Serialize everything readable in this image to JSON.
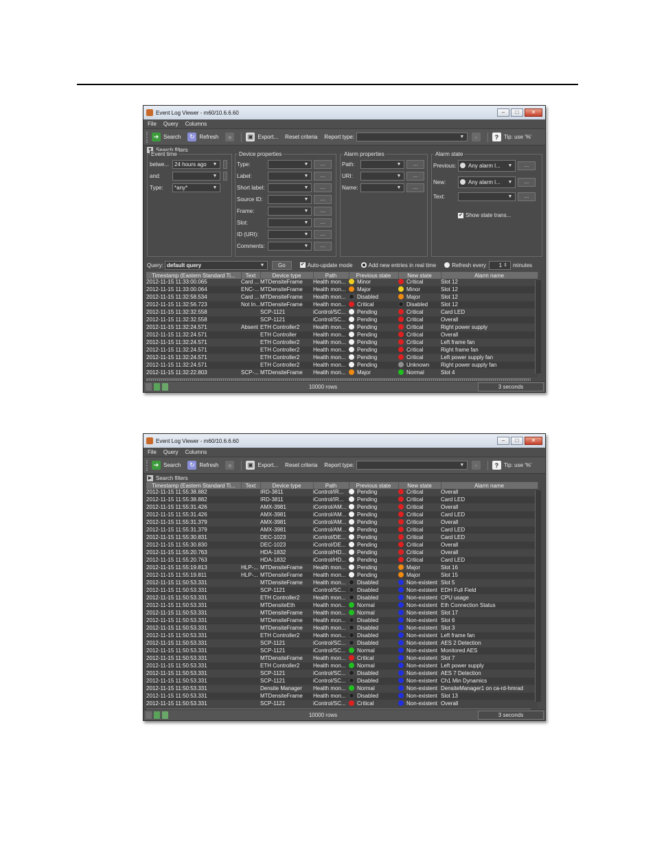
{
  "colors": {
    "critical": "#e02020",
    "major": "#f08a10",
    "minor": "#f0d020",
    "pending": "#f4f4f4",
    "disabled": "#202020",
    "normal": "#20c020",
    "nonexistent": "#2030e0",
    "unknown": "#909090"
  },
  "win1": {
    "title": "Event Log Viewer - m60/10.6.6.60",
    "menu": [
      "File",
      "Query",
      "Columns"
    ],
    "toolbar": {
      "search": "Search",
      "refresh": "Refresh",
      "export": "Export...",
      "reset": "Reset criteria",
      "report_type": "Report type:",
      "tip": "Tip: use '%'"
    },
    "filters_label": "Search filters",
    "event_time": {
      "legend": "Event time",
      "between_label": "betwe...",
      "between_value": "24 hours ago",
      "and_label": "and:",
      "and_value": "",
      "type_label": "Type:",
      "type_value": "*any*"
    },
    "device": {
      "legend": "Device properties",
      "labels": [
        "Type:",
        "Label:",
        "Short label:",
        "Source ID:",
        "Frame:",
        "Slot:",
        "ID (URI):",
        "Comments:"
      ]
    },
    "alarm": {
      "legend": "Alarm properties",
      "labels": [
        "Path:",
        "URI:",
        "Name:"
      ]
    },
    "alarm_state": {
      "legend": "Alarm state",
      "previous_label": "Previous:",
      "previous_value": "Any alarm l...",
      "new_label": "New:",
      "new_value": "Any alarm l...",
      "text_label": "Text:",
      "show_trans": "Show state trans..."
    },
    "query": {
      "label": "Query:",
      "value": "default query",
      "go": "Go",
      "auto_update": "Auto-update mode",
      "add_new": "Add new entries in real time",
      "refresh_every": "Refresh every",
      "refresh_value": "1",
      "minutes": "minutes"
    },
    "columns": [
      "Timestamp (Eastern Standard Ti...",
      "Text",
      "Device type",
      "Path",
      "Previous state",
      "New state",
      "Alarm name"
    ],
    "rows": [
      {
        "ts": "2012-11-15 11:33:00.065",
        "text": "Card ...",
        "dev": "MTDensiteFrame",
        "path": "Health mon...",
        "prev": "Minor",
        "pc": "minor",
        "new": "Critical",
        "nc": "critical",
        "alarm": "Slot 12"
      },
      {
        "ts": "2012-11-15 11:33:00.064",
        "text": "ENC-...",
        "dev": "MTDensiteFrame",
        "path": "Health mon...",
        "prev": "Major",
        "pc": "major",
        "new": "Minor",
        "nc": "minor",
        "alarm": "Slot 12"
      },
      {
        "ts": "2012-11-15 11:32:58.534",
        "text": "Card ...",
        "dev": "MTDensiteFrame",
        "path": "Health mon...",
        "prev": "Disabled",
        "pc": "disabled",
        "new": "Major",
        "nc": "major",
        "alarm": "Slot 12"
      },
      {
        "ts": "2012-11-15 11:32:56.723",
        "text": "Not In...",
        "dev": "MTDensiteFrame",
        "path": "Health mon...",
        "prev": "Critical",
        "pc": "critical",
        "new": "Disabled",
        "nc": "disabled",
        "alarm": "Slot 12"
      },
      {
        "ts": "2012-11-15 11:32:32.558",
        "text": "",
        "dev": "SCP-1121",
        "path": "iControl/SC...",
        "prev": "Pending",
        "pc": "pending",
        "new": "Critical",
        "nc": "critical",
        "alarm": "Card LED"
      },
      {
        "ts": "2012-11-15 11:32:32.558",
        "text": "",
        "dev": "SCP-1121",
        "path": "iControl/SC...",
        "prev": "Pending",
        "pc": "pending",
        "new": "Critical",
        "nc": "critical",
        "alarm": "Overall"
      },
      {
        "ts": "2012-11-15 11:32:24.571",
        "text": "Absent",
        "dev": "ETH Controller2",
        "path": "Health mon...",
        "prev": "Pending",
        "pc": "pending",
        "new": "Critical",
        "nc": "critical",
        "alarm": "Right power supply"
      },
      {
        "ts": "2012-11-15 11:32:24.571",
        "text": "",
        "dev": "ETH Controller",
        "path": "Health mon...",
        "prev": "Pending",
        "pc": "pending",
        "new": "Critical",
        "nc": "critical",
        "alarm": "Overall"
      },
      {
        "ts": "2012-11-15 11:32:24.571",
        "text": "",
        "dev": "ETH Controller2",
        "path": "Health mon...",
        "prev": "Pending",
        "pc": "pending",
        "new": "Critical",
        "nc": "critical",
        "alarm": "Left frame fan"
      },
      {
        "ts": "2012-11-15 11:32:24.571",
        "text": "",
        "dev": "ETH Controller2",
        "path": "Health mon...",
        "prev": "Pending",
        "pc": "pending",
        "new": "Critical",
        "nc": "critical",
        "alarm": "Right frame fan"
      },
      {
        "ts": "2012-11-15 11:32:24.571",
        "text": "",
        "dev": "ETH Controller2",
        "path": "Health mon...",
        "prev": "Pending",
        "pc": "pending",
        "new": "Critical",
        "nc": "critical",
        "alarm": "Left power supply fan"
      },
      {
        "ts": "2012-11-15 11:32:24.571",
        "text": "",
        "dev": "ETH Controller2",
        "path": "Health mon...",
        "prev": "Pending",
        "pc": "pending",
        "new": "Unknown",
        "nc": "unknown",
        "alarm": "Right power supply fan"
      },
      {
        "ts": "2012-11-15 11:32:22.803",
        "text": "SCP-...",
        "dev": "MTDensiteFrame",
        "path": "Health mon...",
        "prev": "Major",
        "pc": "major",
        "new": "Normal",
        "nc": "normal",
        "alarm": "Slot 4"
      }
    ],
    "status": {
      "rows": "10000 rows",
      "refresh": "3 seconds"
    }
  },
  "win2": {
    "title": "Event Log Viewer - m60/10.6.6.60",
    "menu": [
      "File",
      "Query",
      "Columns"
    ],
    "toolbar": {
      "search": "Search",
      "refresh": "Refresh",
      "export": "Export...",
      "reset": "Reset criteria",
      "report_type": "Report type:",
      "tip": "Tip: use '%'"
    },
    "filters_label": "Search filters",
    "columns": [
      "Timestamp (Eastern Standard Ti...",
      "Text",
      "Device type",
      "Path",
      "Previous state",
      "New state",
      "Alarm name"
    ],
    "rows": [
      {
        "ts": "2012-11-15 11:55:38.882",
        "text": "",
        "dev": "IRD-3811",
        "path": "iControl/IR...",
        "prev": "Pending",
        "pc": "pending",
        "new": "Critical",
        "nc": "critical",
        "alarm": "Overall"
      },
      {
        "ts": "2012-11-15 11:55:38.882",
        "text": "",
        "dev": "IRD-3811",
        "path": "iControl/IR...",
        "prev": "Pending",
        "pc": "pending",
        "new": "Critical",
        "nc": "critical",
        "alarm": "Card LED"
      },
      {
        "ts": "2012-11-15 11:55:31.426",
        "text": "",
        "dev": "AMX-3981",
        "path": "iControl/AM...",
        "prev": "Pending",
        "pc": "pending",
        "new": "Critical",
        "nc": "critical",
        "alarm": "Overall"
      },
      {
        "ts": "2012-11-15 11:55:31.426",
        "text": "",
        "dev": "AMX-3981",
        "path": "iControl/AM...",
        "prev": "Pending",
        "pc": "pending",
        "new": "Critical",
        "nc": "critical",
        "alarm": "Card LED"
      },
      {
        "ts": "2012-11-15 11:55:31.379",
        "text": "",
        "dev": "AMX-3981",
        "path": "iControl/AM...",
        "prev": "Pending",
        "pc": "pending",
        "new": "Critical",
        "nc": "critical",
        "alarm": "Overall"
      },
      {
        "ts": "2012-11-15 11:55:31.379",
        "text": "",
        "dev": "AMX-3981",
        "path": "iControl/AM...",
        "prev": "Pending",
        "pc": "pending",
        "new": "Critical",
        "nc": "critical",
        "alarm": "Card LED"
      },
      {
        "ts": "2012-11-15 11:55:30.831",
        "text": "",
        "dev": "DEC-1023",
        "path": "iControl/DE...",
        "prev": "Pending",
        "pc": "pending",
        "new": "Critical",
        "nc": "critical",
        "alarm": "Card LED"
      },
      {
        "ts": "2012-11-15 11:55:30.830",
        "text": "",
        "dev": "DEC-1023",
        "path": "iControl/DE...",
        "prev": "Pending",
        "pc": "pending",
        "new": "Critical",
        "nc": "critical",
        "alarm": "Overall"
      },
      {
        "ts": "2012-11-15 11:55:20.763",
        "text": "",
        "dev": "HDA-1832",
        "path": "iControl/HD...",
        "prev": "Pending",
        "pc": "pending",
        "new": "Critical",
        "nc": "critical",
        "alarm": "Overall"
      },
      {
        "ts": "2012-11-15 11:55:20.763",
        "text": "",
        "dev": "HDA-1832",
        "path": "iControl/HD...",
        "prev": "Pending",
        "pc": "pending",
        "new": "Critical",
        "nc": "critical",
        "alarm": "Card LED"
      },
      {
        "ts": "2012-11-15 11:55:19.813",
        "text": "HLP-...",
        "dev": "MTDensiteFrame",
        "path": "Health mon...",
        "prev": "Pending",
        "pc": "pending",
        "new": "Major",
        "nc": "major",
        "alarm": "Slot 16"
      },
      {
        "ts": "2012-11-15 11:55:19.811",
        "text": "HLP-...",
        "dev": "MTDensiteFrame",
        "path": "Health mon...",
        "prev": "Pending",
        "pc": "pending",
        "new": "Major",
        "nc": "major",
        "alarm": "Slot 15"
      },
      {
        "ts": "2012-11-15 11:50:53.331",
        "text": "",
        "dev": "MTDensiteFrame",
        "path": "Health mon...",
        "prev": "Disabled",
        "pc": "disabled",
        "new": "Non-existent",
        "nc": "nonexistent",
        "alarm": "Slot 5"
      },
      {
        "ts": "2012-11-15 11:50:53.331",
        "text": "",
        "dev": "SCP-1121",
        "path": "iControl/SC...",
        "prev": "Disabled",
        "pc": "disabled",
        "new": "Non-existent",
        "nc": "nonexistent",
        "alarm": "EDH Full Field"
      },
      {
        "ts": "2012-11-15 11:50:53.331",
        "text": "",
        "dev": "ETH Controller2",
        "path": "Health mon...",
        "prev": "Disabled",
        "pc": "disabled",
        "new": "Non-existent",
        "nc": "nonexistent",
        "alarm": "CPU usage"
      },
      {
        "ts": "2012-11-15 11:50:53.331",
        "text": "",
        "dev": "MTDensiteEth",
        "path": "Health mon...",
        "prev": "Normal",
        "pc": "normal",
        "new": "Non-existent",
        "nc": "nonexistent",
        "alarm": "Eth Connection Status"
      },
      {
        "ts": "2012-11-15 11:50:53.331",
        "text": "",
        "dev": "MTDensiteFrame",
        "path": "Health mon...",
        "prev": "Normal",
        "pc": "normal",
        "new": "Non-existent",
        "nc": "nonexistent",
        "alarm": "Slot 17"
      },
      {
        "ts": "2012-11-15 11:50:53.331",
        "text": "",
        "dev": "MTDensiteFrame",
        "path": "Health mon...",
        "prev": "Disabled",
        "pc": "disabled",
        "new": "Non-existent",
        "nc": "nonexistent",
        "alarm": "Slot 6"
      },
      {
        "ts": "2012-11-15 11:50:53.331",
        "text": "",
        "dev": "MTDensiteFrame",
        "path": "Health mon...",
        "prev": "Disabled",
        "pc": "disabled",
        "new": "Non-existent",
        "nc": "nonexistent",
        "alarm": "Slot 3"
      },
      {
        "ts": "2012-11-15 11:50:53.331",
        "text": "",
        "dev": "ETH Controller2",
        "path": "Health mon...",
        "prev": "Disabled",
        "pc": "disabled",
        "new": "Non-existent",
        "nc": "nonexistent",
        "alarm": "Left frame fan"
      },
      {
        "ts": "2012-11-15 11:50:53.331",
        "text": "",
        "dev": "SCP-1121",
        "path": "iControl/SC...",
        "prev": "Disabled",
        "pc": "disabled",
        "new": "Non-existent",
        "nc": "nonexistent",
        "alarm": "AES 2 Detection"
      },
      {
        "ts": "2012-11-15 11:50:53.331",
        "text": "",
        "dev": "SCP-1121",
        "path": "iControl/SC...",
        "prev": "Normal",
        "pc": "normal",
        "new": "Non-existent",
        "nc": "nonexistent",
        "alarm": "Monitored AES"
      },
      {
        "ts": "2012-11-15 11:50:53.331",
        "text": "",
        "dev": "MTDensiteFrame",
        "path": "Health mon...",
        "prev": "Critical",
        "pc": "critical",
        "new": "Non-existent",
        "nc": "nonexistent",
        "alarm": "Slot 7"
      },
      {
        "ts": "2012-11-15 11:50:53.331",
        "text": "",
        "dev": "ETH Controller2",
        "path": "Health mon...",
        "prev": "Normal",
        "pc": "normal",
        "new": "Non-existent",
        "nc": "nonexistent",
        "alarm": "Left power supply"
      },
      {
        "ts": "2012-11-15 11:50:53.331",
        "text": "",
        "dev": "SCP-1121",
        "path": "iControl/SC...",
        "prev": "Disabled",
        "pc": "disabled",
        "new": "Non-existent",
        "nc": "nonexistent",
        "alarm": "AES 7 Detection"
      },
      {
        "ts": "2012-11-15 11:50:53.331",
        "text": "",
        "dev": "SCP-1121",
        "path": "iControl/SC...",
        "prev": "Disabled",
        "pc": "disabled",
        "new": "Non-existent",
        "nc": "nonexistent",
        "alarm": "Ch1 Min Dynamics"
      },
      {
        "ts": "2012-11-15 11:50:53.331",
        "text": "",
        "dev": "Densite Manager",
        "path": "Health mon...",
        "prev": "Normal",
        "pc": "normal",
        "new": "Non-existent",
        "nc": "nonexistent",
        "alarm": "DensiteManager1 on ca-rd-hmrad"
      },
      {
        "ts": "2012-11-15 11:50:53.331",
        "text": "",
        "dev": "MTDensiteFrame",
        "path": "Health mon...",
        "prev": "Disabled",
        "pc": "disabled",
        "new": "Non-existent",
        "nc": "nonexistent",
        "alarm": "Slot 13"
      },
      {
        "ts": "2012-11-15 11:50:53.331",
        "text": "",
        "dev": "SCP-1121",
        "path": "iControl/SC...",
        "prev": "Critical",
        "pc": "critical",
        "new": "Non-existent",
        "nc": "nonexistent",
        "alarm": "Overall"
      }
    ],
    "status": {
      "rows": "10000 rows",
      "refresh": "3 seconds"
    }
  }
}
